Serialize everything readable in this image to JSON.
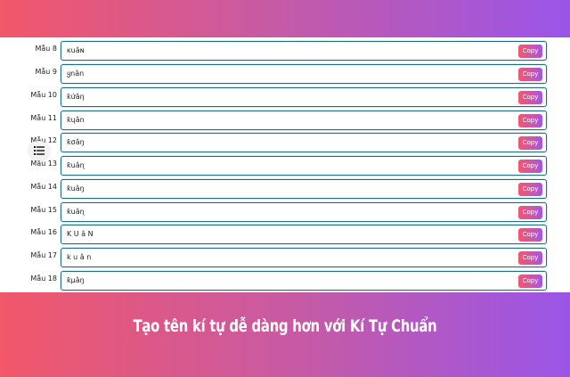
{
  "rows": [
    {
      "label": "Mẫu 8",
      "value": "ĸuâɴ",
      "button": "Copy"
    },
    {
      "label": "Mẫu 9",
      "value": "ყnân",
      "button": "Copy"
    },
    {
      "label": "Mẫu 10",
      "value": "ƙứâη",
      "button": "Copy"
    },
    {
      "label": "Mẫu 11",
      "value": "ƙųân",
      "button": "Copy"
    },
    {
      "label": "Mẫu 12",
      "value": "ƙσâŋ",
      "button": "Copy"
    },
    {
      "label": "Mẫu 13",
      "value": "ƙuâɳ",
      "button": "Copy"
    },
    {
      "label": "Mẫu 14",
      "value": "ƙuâŋ",
      "button": "Copy"
    },
    {
      "label": "Mẫu 15",
      "value": "ƙuâɳ",
      "button": "Copy"
    },
    {
      "label": "Mẫu 16",
      "value": "K U â N",
      "button": "Copy"
    },
    {
      "label": "Mẫu 17",
      "value": "k u â n",
      "button": "Copy"
    },
    {
      "label": "Mẫu 18",
      "value": "ƙμâŋ",
      "button": "Copy"
    }
  ],
  "banner": {
    "title": "Tạo tên kí tự dễ dàng hơn với Kí Tự Chuẩn"
  },
  "icons": {
    "toc": "list-icon"
  },
  "colors": {
    "gradient_start": "#f2576a",
    "gradient_end": "#9a55e8",
    "input_border": "#1e6f86"
  }
}
